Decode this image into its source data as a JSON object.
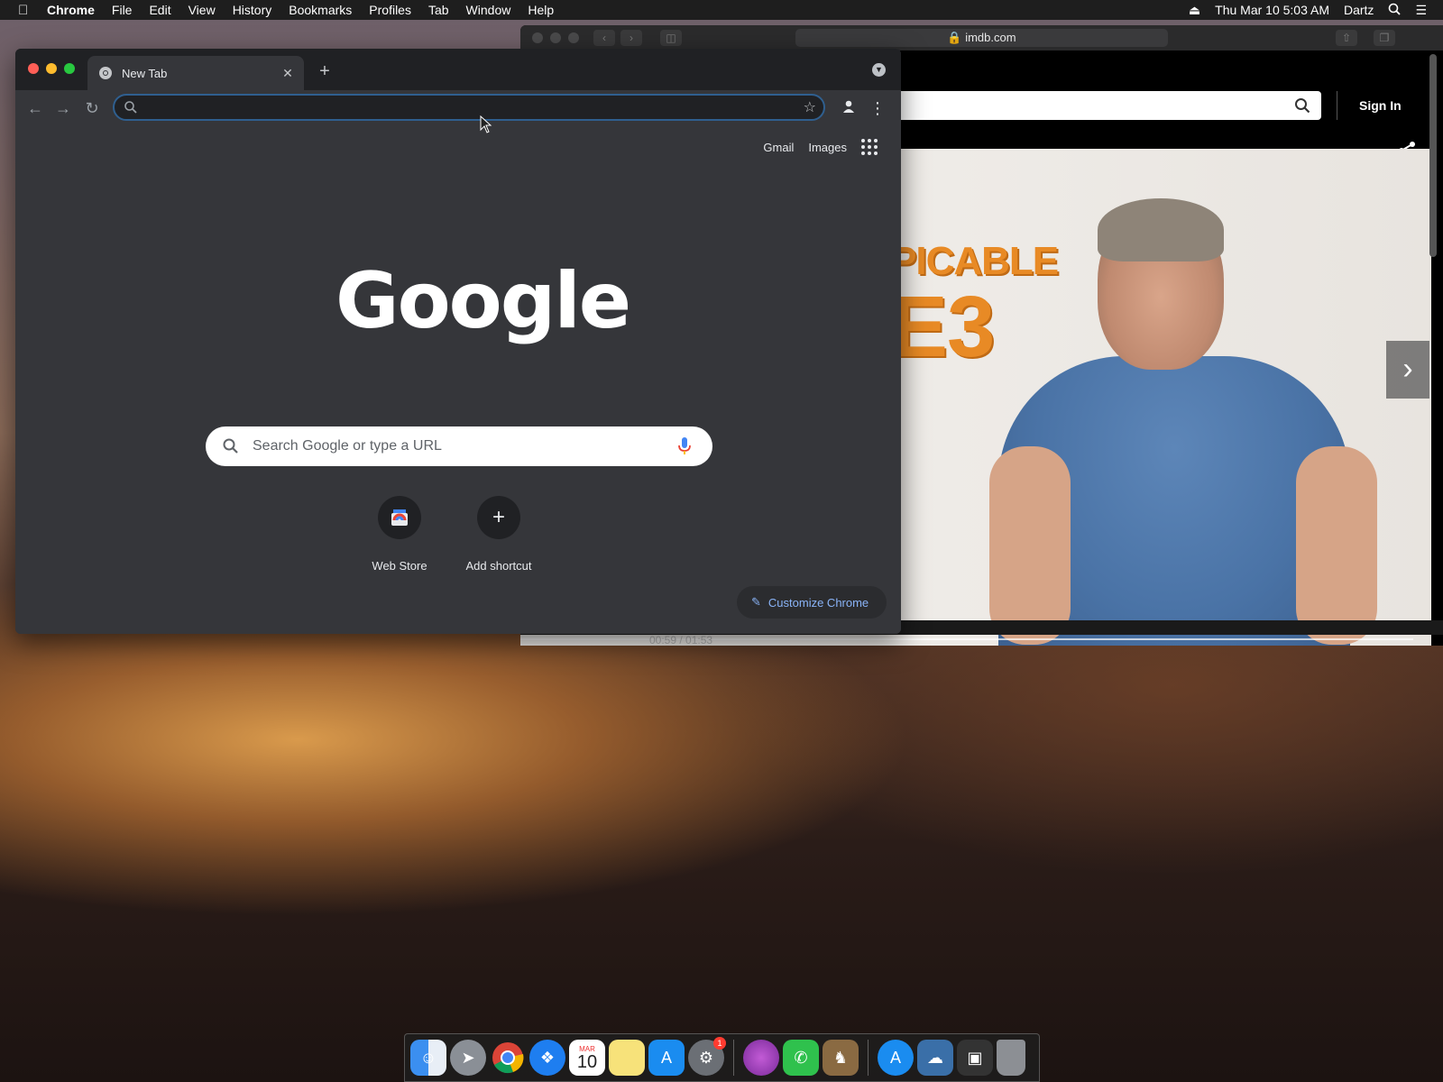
{
  "menubar": {
    "app_name": "Chrome",
    "items": [
      "File",
      "Edit",
      "View",
      "History",
      "Bookmarks",
      "Profiles",
      "Tab",
      "Window",
      "Help"
    ],
    "clock": "Thu Mar 10  5:03 AM",
    "user": "Dartz"
  },
  "safari": {
    "url": "imdb.com",
    "sign_in": "Sign In",
    "poster_line1": "PICABLE",
    "poster_line2": "E3",
    "video_time": "00:59  /  01:53"
  },
  "chrome": {
    "tab_title": "New Tab",
    "omnibox_value": "",
    "ntp": {
      "gmail": "Gmail",
      "images": "Images",
      "logo": "Google",
      "search_placeholder": "Search Google or type a URL",
      "shortcuts": [
        {
          "label": "Web Store"
        },
        {
          "label": "Add shortcut",
          "glyph": "+"
        }
      ],
      "customize": "Customize Chrome"
    }
  },
  "dock": {
    "calendar_day": "10",
    "calendar_month": "MAR",
    "sysprefs_badge": "1"
  },
  "colors": {
    "chrome_bg": "#35363a",
    "chrome_titlebar": "#202124",
    "accent_blue": "#8ab4f8"
  }
}
